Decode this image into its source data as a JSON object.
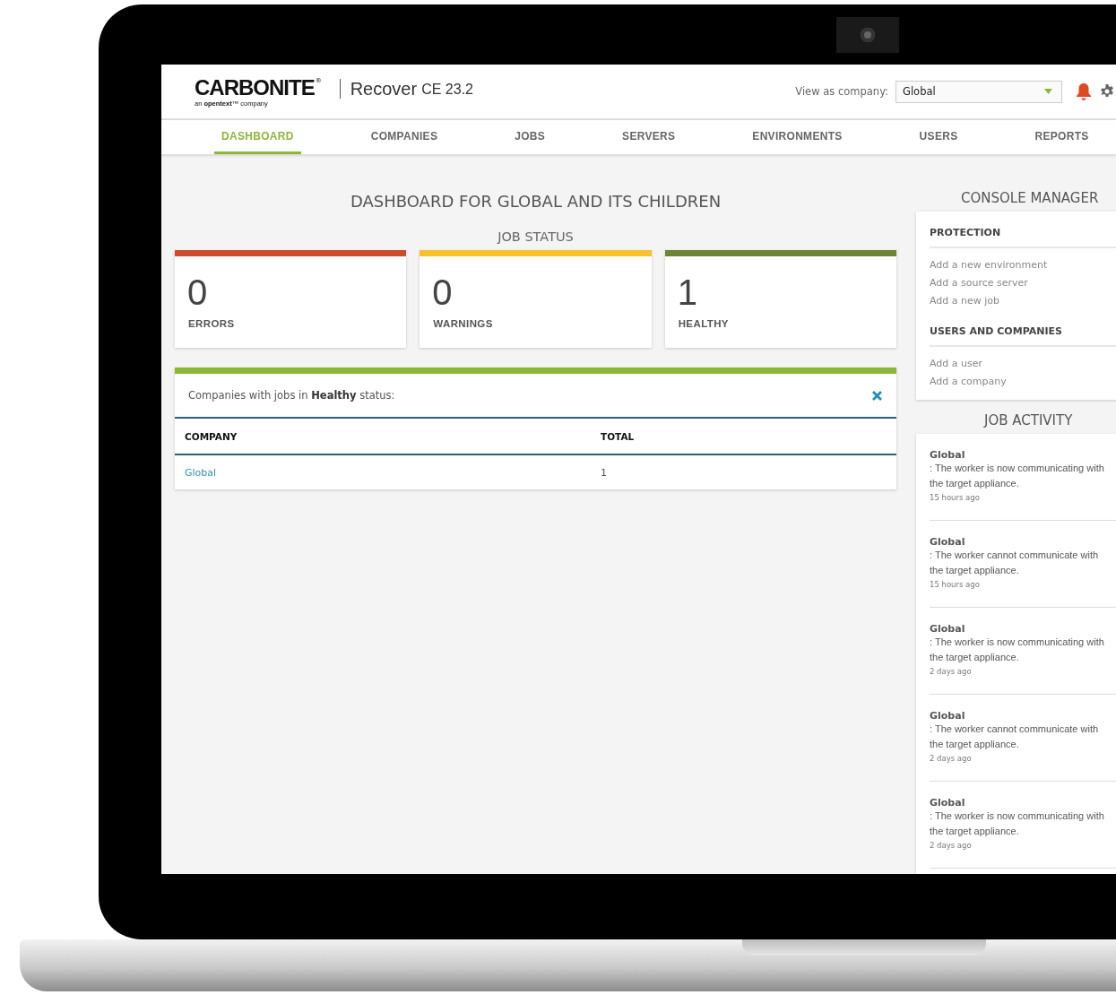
{
  "header": {
    "logo": "CARBONITE",
    "logo_mark": "®",
    "tagline": "an **opentext**™ company",
    "product": "Recover",
    "version": "CE 23.2",
    "company_label": "View as company:",
    "company_value": "Global"
  },
  "nav": [
    {
      "label": "DASHBOARD",
      "selected": true
    },
    {
      "label": "COMPANIES",
      "selected": false
    },
    {
      "label": "JOBS",
      "selected": false
    },
    {
      "label": "SERVERS",
      "selected": false
    },
    {
      "label": "ENVIRONMENTS",
      "selected": false
    },
    {
      "label": "USERS",
      "selected": false
    },
    {
      "label": "REPORTS",
      "selected": false
    }
  ],
  "dashboard_title": "DASHBOARD FOR GLOBAL AND ITS CHILDREN",
  "job_status_title": "JOB STATUS",
  "status_cards": [
    {
      "count": "0",
      "label": "ERRORS",
      "color": "#cc4b2c"
    },
    {
      "count": "0",
      "label": "WARNINGS",
      "color": "#f9c02c"
    },
    {
      "count": "1",
      "label": "HEALTHY",
      "color": "#6b8532"
    }
  ],
  "detail_panel": {
    "message": "Companies with jobs in **Healthy** status:",
    "columns": [
      "COMPANY",
      "TOTAL"
    ],
    "rows": [
      [
        "Global",
        "1"
      ]
    ]
  },
  "console_manager": {
    "title": "CONSOLE MANAGER",
    "sections": [
      {
        "heading": "PROTECTION",
        "links": [
          "Add a new environment",
          "Add a source server",
          "Add a new job"
        ]
      },
      {
        "heading": "USERS AND COMPANIES",
        "links": [
          "Add a user",
          "Add a company"
        ]
      }
    ]
  },
  "job_activity": {
    "title": "JOB ACTIVITY",
    "items": [
      {
        "company": "Global",
        "message": ": The worker is now communicating with the target appliance.",
        "time": "15 hours ago"
      },
      {
        "company": "Global",
        "message": ": The worker cannot communicate with the target appliance.",
        "time": "15 hours ago"
      },
      {
        "company": "Global",
        "message": ": The worker is now communicating with the target appliance.",
        "time": "2 days ago"
      },
      {
        "company": "Global",
        "message": ": The worker cannot communicate with the target appliance.",
        "time": "2 days ago"
      },
      {
        "company": "Global",
        "message": ": The worker is now communicating with the target appliance.",
        "time": "2 days ago"
      }
    ]
  }
}
